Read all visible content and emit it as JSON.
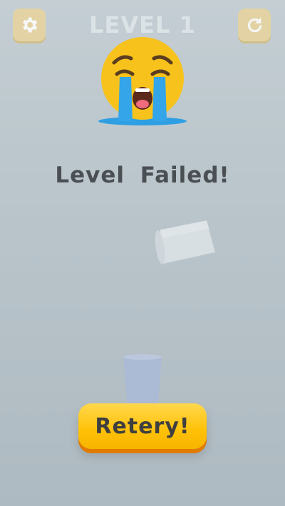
{
  "header": {
    "level_title": "LEVEL 1",
    "settings_icon": "gear-icon",
    "restart_icon": "restart-icon"
  },
  "result": {
    "emoji": "loudly-crying-face-icon",
    "message": "Level Failed!"
  },
  "actions": {
    "retry_label": "Retery!"
  },
  "colors": {
    "button_yellow": "#ffc107",
    "button_shadow": "#e07b00",
    "text_dark": "#4a4f54",
    "emoji_yellow": "#f7c21c",
    "tear_blue": "#33a5e8"
  }
}
